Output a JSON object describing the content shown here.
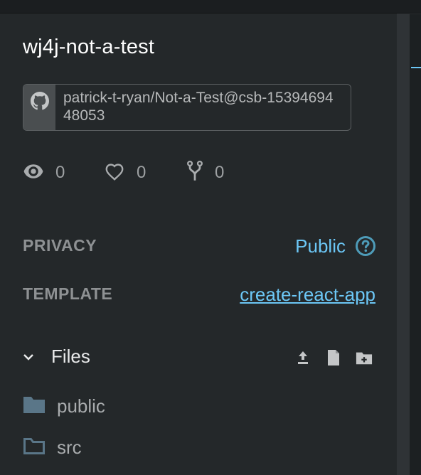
{
  "sandbox": {
    "title": "wj4j-not-a-test",
    "git_source": "patrick-t-ryan/Not-a-Test@csb-1539469448053"
  },
  "stats": {
    "views": "0",
    "likes": "0",
    "forks": "0"
  },
  "privacy": {
    "label": "PRIVACY",
    "value": "Public"
  },
  "template": {
    "label": "TEMPLATE",
    "value": "create-react-app"
  },
  "files": {
    "label": "Files",
    "items": [
      {
        "name": "public",
        "icon": "folder-filled-icon"
      },
      {
        "name": "src",
        "icon": "folder-outline-icon"
      }
    ]
  },
  "colors": {
    "sidebar_bg": "#24282a",
    "accent": "#6cc7f6",
    "muted_text": "#8e9193"
  }
}
